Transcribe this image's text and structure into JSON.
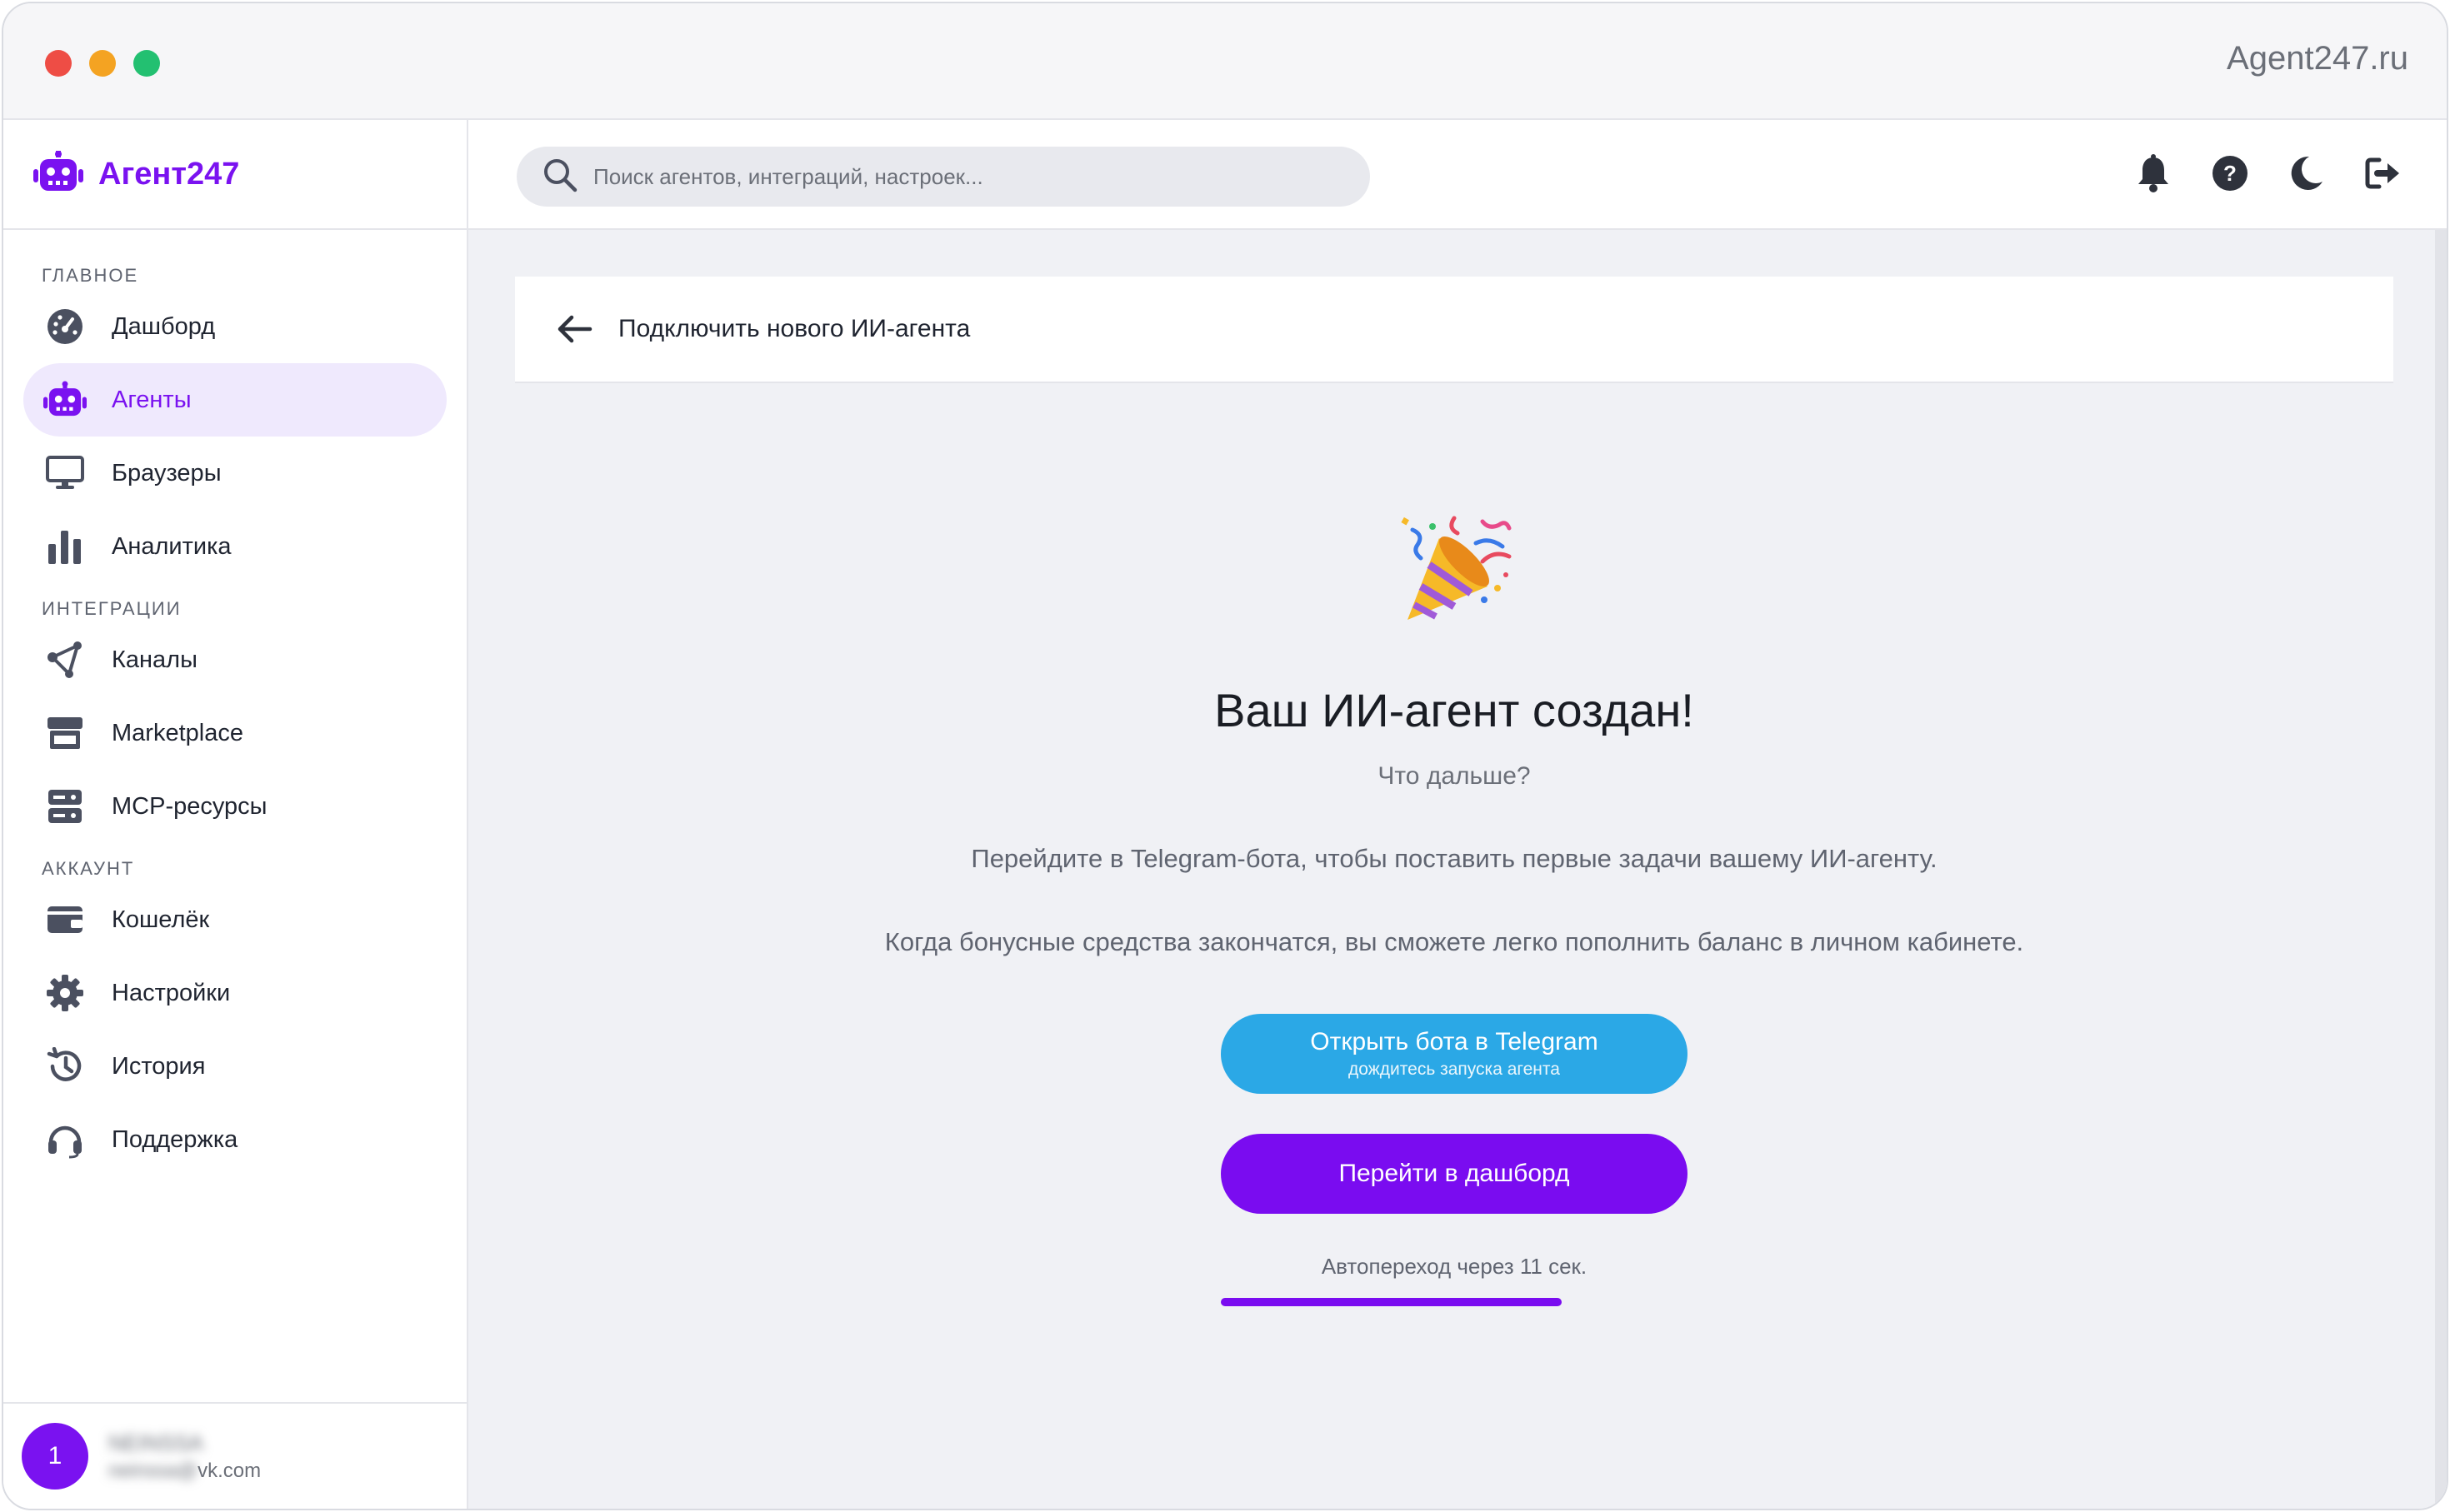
{
  "window": {
    "site_url": "Agent247.ru"
  },
  "brand": {
    "name": "Агент247",
    "accent": "#7a12f0"
  },
  "search": {
    "placeholder": "Поиск агентов, интеграций, настроек..."
  },
  "header_icons": [
    "bell-icon",
    "help-icon",
    "moon-icon",
    "logout-icon"
  ],
  "sidebar": {
    "sections": [
      {
        "label": "ГЛАВНОЕ",
        "items": [
          {
            "label": "Дашборд",
            "icon": "gauge-icon",
            "active": false
          },
          {
            "label": "Агенты",
            "icon": "robot-icon",
            "active": true
          },
          {
            "label": "Браузеры",
            "icon": "monitor-icon",
            "active": false
          },
          {
            "label": "Аналитика",
            "icon": "bar-chart-icon",
            "active": false
          }
        ]
      },
      {
        "label": "ИНТЕГРАЦИИ",
        "items": [
          {
            "label": "Каналы",
            "icon": "share-icon",
            "active": false
          },
          {
            "label": "Marketplace",
            "icon": "store-icon",
            "active": false
          },
          {
            "label": "MCP-ресурсы",
            "icon": "server-icon",
            "active": false
          }
        ]
      },
      {
        "label": "АККАУНТ",
        "items": [
          {
            "label": "Кошелёк",
            "icon": "wallet-icon",
            "active": false
          },
          {
            "label": "Настройки",
            "icon": "gear-icon",
            "active": false
          },
          {
            "label": "История",
            "icon": "history-icon",
            "active": false
          },
          {
            "label": "Поддержка",
            "icon": "headset-icon",
            "active": false
          }
        ]
      }
    ]
  },
  "user": {
    "avatar_text": "1",
    "name": "NEINSSA",
    "email_prefix": "neinssa@",
    "email_suffix": "vk.com"
  },
  "page": {
    "title": "Подключить нового ИИ-агента",
    "headline": "Ваш ИИ-агент создан!",
    "subhead": "Что дальше?",
    "paragraph1": "Перейдите в Telegram-бота, чтобы поставить первые задачи вашему ИИ-агенту.",
    "paragraph2": "Когда бонусные средства закончатся, вы сможете легко пополнить баланс в личном кабинете.",
    "telegram_button": {
      "label": "Открыть бота в Telegram",
      "sublabel": "дождитесь запуска агента",
      "color": "#2ba8e6"
    },
    "dashboard_button": {
      "label": "Перейти в дашборд",
      "color": "#7a0cf0"
    },
    "auto_redirect": "Автопереход через 11 сек.",
    "progress_fraction": 0.73
  }
}
